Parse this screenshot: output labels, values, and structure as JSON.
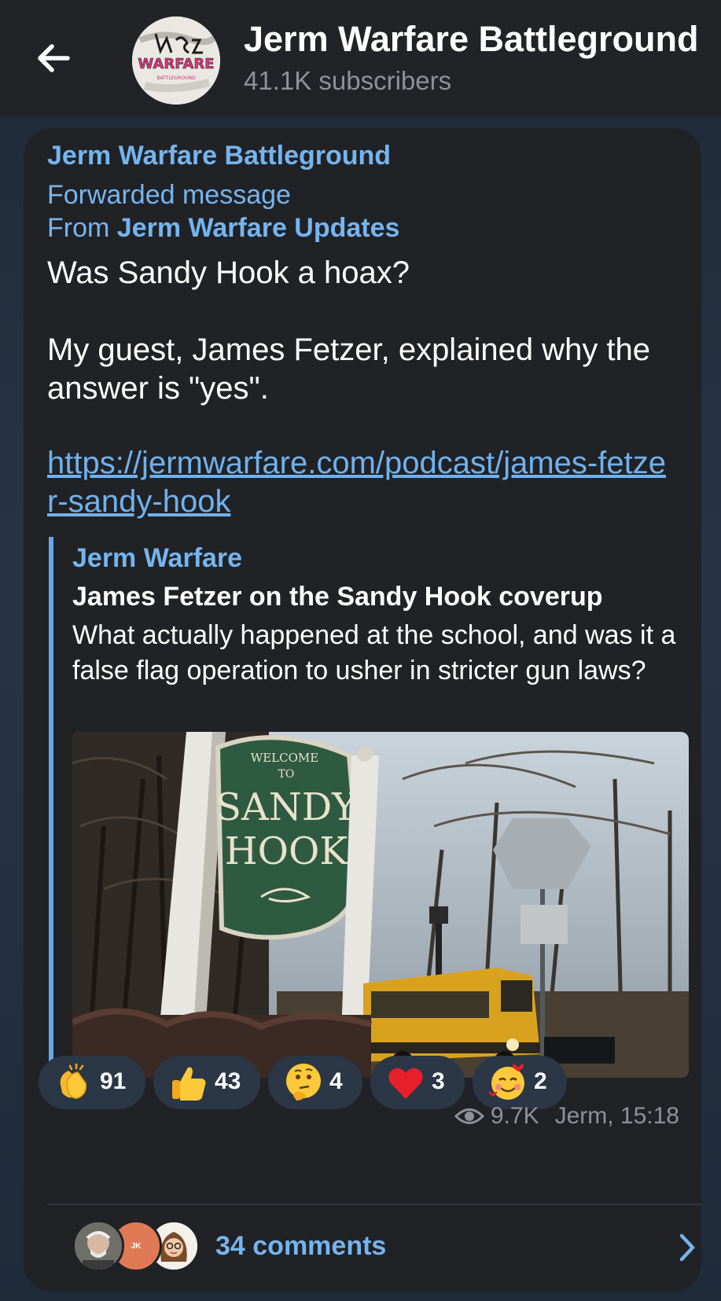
{
  "header": {
    "title": "Jerm Warfare Battleground",
    "subscribers": "41.1K subscribers",
    "avatar_logo_text": "WARFARE",
    "avatar_sub_text": "BATTLEGROUND"
  },
  "message": {
    "author": "Jerm Warfare Battleground",
    "forwarded_label": "Forwarded message",
    "from_prefix": "From",
    "from_channel": "Jerm Warfare Updates",
    "paragraph1": "Was Sandy Hook a hoax?",
    "paragraph2": "My guest, James Fetzer, explained why the answer is \"yes\".",
    "link": "https://jermwarfare.com/podcast/james-fetzer-sandy-hook"
  },
  "preview": {
    "site": "Jerm Warfare",
    "title": "James Fetzer on the Sandy Hook coverup",
    "description": "What actually happened at the school, and was it a false flag operation to usher in stricter gun laws?",
    "sign_welcome": "WELCOME",
    "sign_to": "TO",
    "sign_line1": "SANDY",
    "sign_line2": "HOOK"
  },
  "reactions": [
    {
      "icon": "clapping-hands-icon",
      "count": "91"
    },
    {
      "icon": "thumbs-up-icon",
      "count": "43"
    },
    {
      "icon": "thinking-face-icon",
      "count": "4"
    },
    {
      "icon": "red-heart-icon",
      "count": "3"
    },
    {
      "icon": "smiling-face-with-hearts-icon",
      "count": "2"
    }
  ],
  "meta": {
    "views": "9.7K",
    "signature": "Jerm, 15:18"
  },
  "comments": {
    "label": "34 comments",
    "avatar2_initials": "JK"
  },
  "colors": {
    "accent": "#75b5ef",
    "bubble": "#212226",
    "header": "#212327",
    "reaction_bg": "#2b3746"
  }
}
